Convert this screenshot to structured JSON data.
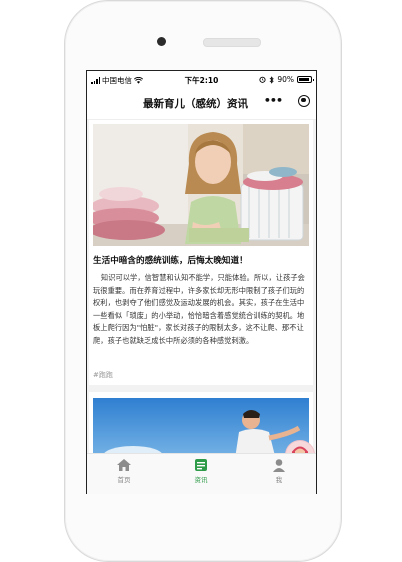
{
  "status_bar": {
    "carrier": "中国电信",
    "time": "下午2:10",
    "battery": "90%"
  },
  "nav": {
    "title": "最新育儿（感统）资讯",
    "more_icon": "more-dots-icon",
    "close_icon": "capsule-target-icon"
  },
  "article": {
    "title": "生活中暗含的感统训练，后悔太晚知道！",
    "body": "知识可以学，信智慧和认知不能学，只能体验。所以，让孩子会玩很重要。而在养育过程中，许多家长却无形中限制了孩子们玩的权利，也剥夺了他们感觉及运动发展的机会。其实，孩子在生活中一些看似「琐废」的小举动，恰恰暗含着感觉统合训练的契机。地板上爬行因为\"怕脏\"，家长对孩子的限制太多，这不让爬、那不让爬，孩子也就缺乏成长中所必须的各种感觉刺激。",
    "tag": "#跑跑"
  },
  "tabbar": {
    "tabs": [
      {
        "label": "首页",
        "icon": "home-icon",
        "active": false
      },
      {
        "label": "资讯",
        "icon": "news-icon",
        "active": true
      },
      {
        "label": "我",
        "icon": "user-icon",
        "active": false
      }
    ]
  },
  "colors": {
    "accent": "#2e9b49",
    "inactive": "#888888"
  }
}
